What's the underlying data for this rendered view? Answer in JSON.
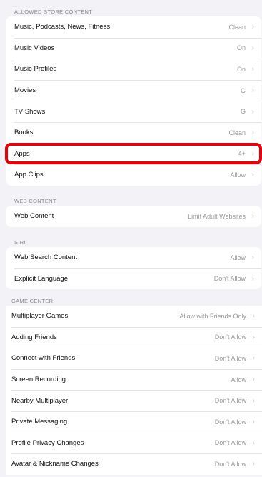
{
  "allowed_store": {
    "header": "ALLOWED STORE CONTENT",
    "rows": [
      {
        "label": "Music, Podcasts, News, Fitness",
        "value": "Clean"
      },
      {
        "label": "Music Videos",
        "value": "On"
      },
      {
        "label": "Music Profiles",
        "value": "On"
      },
      {
        "label": "Movies",
        "value": "G"
      },
      {
        "label": "TV Shows",
        "value": "G"
      },
      {
        "label": "Books",
        "value": "Clean"
      },
      {
        "label": "Apps",
        "value": "4+"
      },
      {
        "label": "App Clips",
        "value": "Allow"
      }
    ]
  },
  "web_content": {
    "header": "WEB CONTENT",
    "rows": [
      {
        "label": "Web Content",
        "value": "Limit Adult Websites"
      }
    ]
  },
  "siri": {
    "header": "SIRI",
    "rows": [
      {
        "label": "Web Search Content",
        "value": "Allow"
      },
      {
        "label": "Explicit Language",
        "value": "Don't Allow"
      }
    ]
  },
  "game_center": {
    "header": "GAME CENTER",
    "rows": [
      {
        "label": "Multiplayer Games",
        "value": "Allow with Friends Only"
      },
      {
        "label": "Adding Friends",
        "value": "Don't Allow"
      },
      {
        "label": "Connect with Friends",
        "value": "Don't Allow"
      },
      {
        "label": "Screen Recording",
        "value": "Allow"
      },
      {
        "label": "Nearby Multiplayer",
        "value": "Don't Allow"
      },
      {
        "label": "Private Messaging",
        "value": "Don't Allow"
      },
      {
        "label": "Profile Privacy Changes",
        "value": "Don't Allow"
      },
      {
        "label": "Avatar & Nickname Changes",
        "value": "Don't Allow"
      }
    ]
  },
  "chevron": "›",
  "colors": {
    "highlight": "#e8000b",
    "background": "#f2f2f7"
  }
}
